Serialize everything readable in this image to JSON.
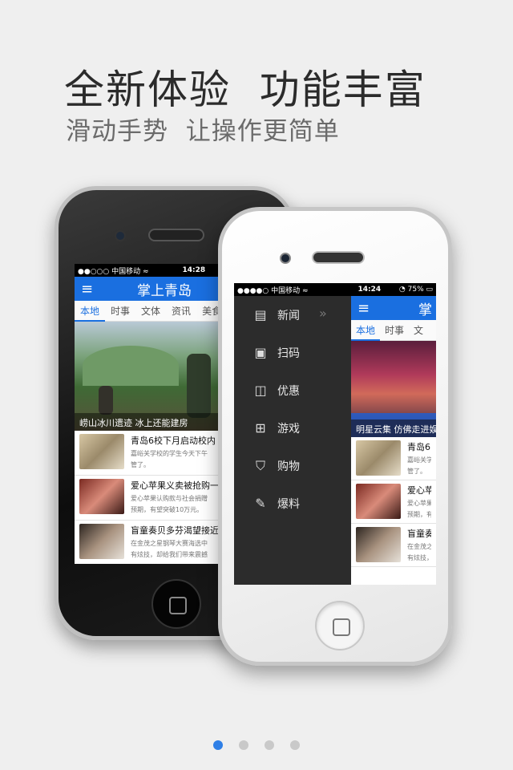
{
  "headline": {
    "title": "全新体验  功能丰富",
    "subtitle": "滑动手势  让操作更简单"
  },
  "colors": {
    "accent": "#1a6fe0",
    "background": "#efefef",
    "pager_active": "#2f7fe6",
    "pager_inactive": "#c9c9c9"
  },
  "back_phone": {
    "status": {
      "carrier": "●●○○○ 中国移动 ≈",
      "time": "14:28"
    },
    "header": {
      "menu_icon": "≡",
      "title": "掌上青岛"
    },
    "tabs": [
      "本地",
      "时事",
      "文体",
      "资讯",
      "美食"
    ],
    "hero_caption": "崂山冰川遗迹 冰上还能建房",
    "news": [
      {
        "title": "青岛6校下月启动校内",
        "summary": "嘉峪关学校的学生今天下午",
        "summary2": "管了。"
      },
      {
        "title": "爱心苹果义卖被抢购一",
        "summary": "爱心苹果认购款与社会捐赠",
        "summary2": "预期，有望突破10万元。"
      },
      {
        "title": "盲童奏贝多芬渴望接近",
        "summary": "在金茂之星钢琴大赛海选中",
        "summary2": "有炫技，却给我们带来震撼"
      }
    ]
  },
  "front_phone": {
    "status": {
      "carrier": "●●●●○ 中国移动 ≈",
      "time": "14:24",
      "battery": "◔ 75% ▭"
    },
    "drawer": [
      {
        "icon": "news-icon",
        "glyph": "▤",
        "label": "新闻"
      },
      {
        "icon": "scan-icon",
        "glyph": "▣",
        "label": "扫码"
      },
      {
        "icon": "coupon-icon",
        "glyph": "◫",
        "label": "优惠"
      },
      {
        "icon": "game-icon",
        "glyph": "⊞",
        "label": "游戏"
      },
      {
        "icon": "shopping-icon",
        "glyph": "⛉",
        "label": "购物"
      },
      {
        "icon": "report-icon",
        "glyph": "✎",
        "label": "爆料"
      }
    ],
    "drawer_arrow": "»",
    "peek": {
      "menu_icon": "≡",
      "title": "掌",
      "tabs": [
        "本地",
        "时事",
        "文"
      ],
      "hero_caption": "明星云集 仿佛走进娱",
      "news": [
        {
          "title": "青岛6",
          "summary": "嘉峪关学",
          "summary2": "管了。"
        },
        {
          "title": "爱心苹",
          "summary": "爱心苹果",
          "summary2": "预期，有"
        },
        {
          "title": "盲童奏",
          "summary": "在金茂之",
          "summary2": "有炫技，"
        }
      ]
    }
  },
  "pager": {
    "total": 4,
    "active": 1
  }
}
